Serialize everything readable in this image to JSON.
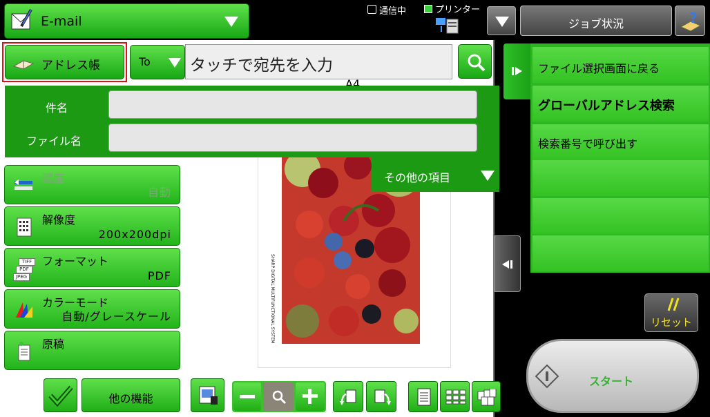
{
  "header": {
    "mode_label": "E-mail",
    "comm_label": "通信中",
    "printer_label": "プリンター",
    "job_status_label": "ジョブ状況"
  },
  "address": {
    "book_label": "アドレス帳",
    "to_label": "To",
    "dest_placeholder": "タッチで宛先を入力",
    "annotation": "A4"
  },
  "form": {
    "subject_label": "件名",
    "subject_value": "",
    "filename_label": "ファイル名",
    "filename_value": "",
    "other_items_label": "その他の項目"
  },
  "settings": [
    {
      "label": "濃度",
      "value": "自動"
    },
    {
      "label": "解像度",
      "value": "200x200dpi"
    },
    {
      "label": "フォーマット",
      "value": "PDF"
    },
    {
      "label": "カラーモード",
      "value": "自動/グレースケール"
    },
    {
      "label": "原稿",
      "value": ""
    }
  ],
  "icons": {
    "format_icon_tiff": "TIFF",
    "format_icon_pdf": "PDF",
    "format_icon_jpeg": "JPEG"
  },
  "preview": {
    "side_text": "SHARP DIGITAL MULTIFUNCTIONAL SYSTEM"
  },
  "bottom": {
    "other_functions_label": "他の機能"
  },
  "right_panel": {
    "items": [
      "ファイル選択画面に戻る",
      "グローバルアドレス検索",
      "検索番号で呼び出す",
      "",
      "",
      ""
    ]
  },
  "reset_label": "リセット",
  "start_label": "スタート",
  "colors": {
    "accent_green": "#1c9a13",
    "highlight_red": "#e01010"
  }
}
